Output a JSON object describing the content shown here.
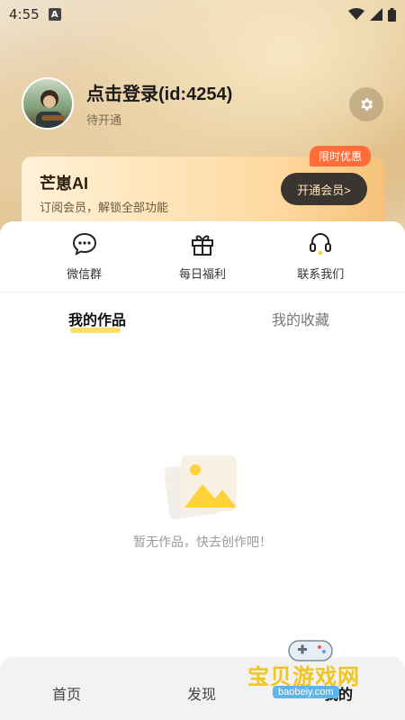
{
  "status_bar": {
    "time": "4:55",
    "app_badge": "A"
  },
  "profile": {
    "name": "点击登录(id:4254)",
    "status": "待开通"
  },
  "vip_card": {
    "title": "芒崽AI",
    "subtitle": "订阅会员，解锁全部功能",
    "badge": "限时优惠",
    "button": "开通会员>"
  },
  "quick_actions": [
    {
      "label": "微信群",
      "icon": "chat-bubble-icon"
    },
    {
      "label": "每日福利",
      "icon": "gift-icon"
    },
    {
      "label": "联系我们",
      "icon": "headset-icon"
    }
  ],
  "tabs": [
    {
      "label": "我的作品",
      "active": true
    },
    {
      "label": "我的收藏",
      "active": false
    }
  ],
  "empty_state": {
    "text": "暂无作品，快去创作吧！",
    "icon": "image-placeholder-icon"
  },
  "bottom_nav": [
    {
      "label": "首页"
    },
    {
      "label": "发现"
    },
    {
      "label": "我的"
    }
  ],
  "watermark": {
    "cn": "宝贝游戏网",
    "en": "baobeiy.com"
  },
  "colors": {
    "accent": "#ffe064",
    "vip_badge": "#ff6d3a",
    "vip_button": "#3a3530"
  }
}
